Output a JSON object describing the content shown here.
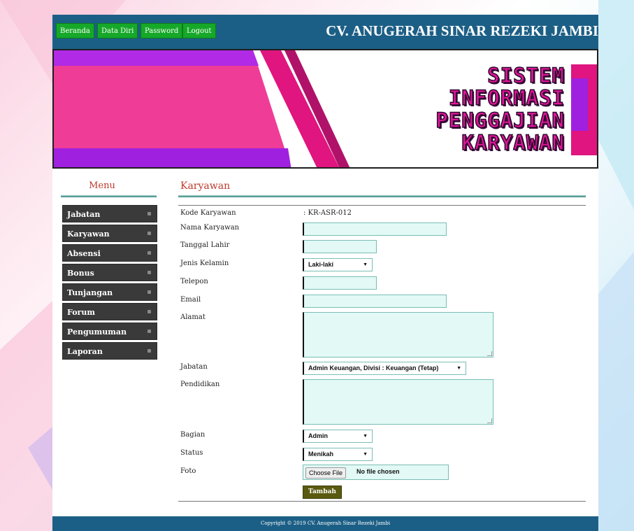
{
  "colors": {
    "header_bg": "#1c5f86",
    "nav_button_bg": "#16a829",
    "banner_pink": "#ef3c97",
    "banner_purple": "#a020e0",
    "section_title": "#c0392b",
    "input_bg": "#e2f9f5",
    "menu_bg": "#3a3a3a",
    "submit_bg": "#5b5b10"
  },
  "nav": {
    "items": [
      {
        "label": "Beranda"
      },
      {
        "label": "Data Diri"
      },
      {
        "label": "Password"
      },
      {
        "label": "Logout"
      }
    ],
    "brand": "CV. ANUGERAH SINAR REZEKI JAMBI"
  },
  "banner": {
    "lines": [
      "SISTEM",
      "INFORMASI",
      "PENGGAJIAN",
      "KARYAWAN"
    ]
  },
  "sidebar": {
    "title": "Menu",
    "items": [
      {
        "label": "Jabatan"
      },
      {
        "label": "Karyawan"
      },
      {
        "label": "Absensi"
      },
      {
        "label": "Bonus"
      },
      {
        "label": "Tunjangan"
      },
      {
        "label": "Forum"
      },
      {
        "label": "Pengumuman"
      },
      {
        "label": "Laporan"
      }
    ]
  },
  "form": {
    "title": "Karyawan",
    "kode_label": "Kode Karyawan",
    "kode_value": ": KR-ASR-012",
    "nama_label": "Nama Karyawan",
    "tanggal_label": "Tanggal Lahir",
    "jenis_label": "Jenis Kelamin",
    "jenis_value": "Laki-laki",
    "telepon_label": "Telepon",
    "email_label": "Email",
    "alamat_label": "Alamat",
    "jabatan_label": "Jabatan",
    "jabatan_value": "Admin Keuangan, Divisi : Keuangan (Tetap)",
    "pendidikan_label": "Pendidikan",
    "bagian_label": "Bagian",
    "bagian_value": "Admin",
    "status_label": "Status",
    "status_value": "Menikah",
    "foto_label": "Foto",
    "file_button": "Choose File",
    "file_status": "No file chosen",
    "submit_label": "Tambah"
  },
  "footer": {
    "text": "Copyright © 2019 CV. Anugerah Sinar Rezeki Jambi"
  }
}
